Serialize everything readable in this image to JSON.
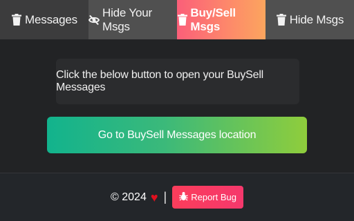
{
  "tabs": [
    {
      "label": "Messages",
      "icon": "trash-icon",
      "active": false
    },
    {
      "label": "Hide Your Msgs",
      "icon": "eye-slash-icon",
      "active": false
    },
    {
      "label": "Buy/Sell Msgs",
      "icon": "trash-icon",
      "active": true
    },
    {
      "label": "Hide Msgs",
      "icon": "trash-icon",
      "active": false
    }
  ],
  "main": {
    "info_text": "Click the below button to open your BuySell Messages",
    "go_button_label": "Go to BuySell Messages location"
  },
  "footer": {
    "copyright": "© 2024",
    "heart": "♥",
    "separator": "|",
    "report_label": "Report Bug"
  },
  "colors": {
    "active_tab_gradient_start": "#fb5f79",
    "active_tab_gradient_end": "#fca55e",
    "go_button_gradient_start": "#12b38d",
    "go_button_gradient_end": "#8fcd3c",
    "report_button": "#fb3d5b",
    "heart": "#e0101e"
  }
}
